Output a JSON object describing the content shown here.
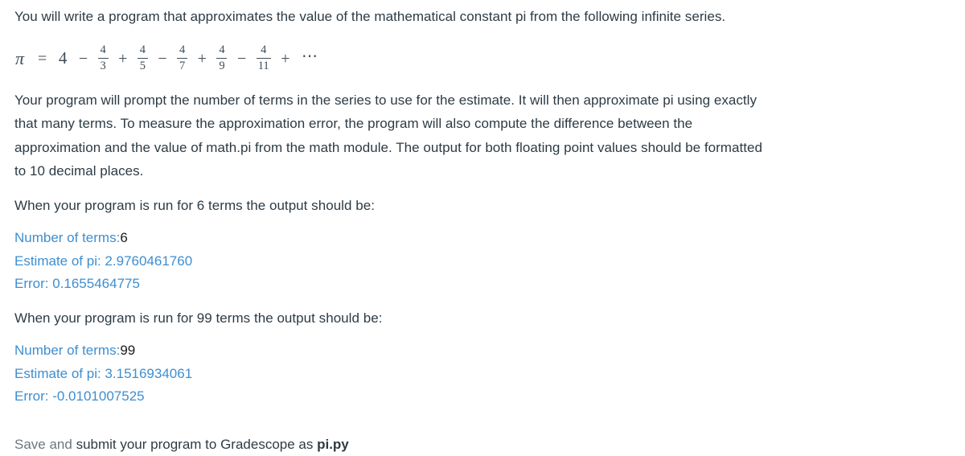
{
  "intro": {
    "paragraph": "You will write a program that approximates the value of the mathematical constant pi from the following infinite series."
  },
  "formula": {
    "lhs": "π",
    "equals": "=",
    "first_term": "4",
    "terms": [
      {
        "op": "−",
        "numerator": "4",
        "denominator": "3"
      },
      {
        "op": "+",
        "numerator": "4",
        "denominator": "5"
      },
      {
        "op": "−",
        "numerator": "4",
        "denominator": "7"
      },
      {
        "op": "+",
        "numerator": "4",
        "denominator": "9"
      },
      {
        "op": "−",
        "numerator": "4",
        "denominator": "11"
      }
    ],
    "trailing_op": "+",
    "ellipsis": "⋯"
  },
  "description": {
    "paragraph": "Your program will prompt the number of terms in the series to use for the estimate. It will then approximate pi using exactly that many terms. To measure the approximation error, the program will also compute the difference between the approximation and the value of math.pi from the math module.  The output for both floating point values should be formatted to 10 decimal places."
  },
  "examples": [
    {
      "prompt": "When your program is run for 6 terms the output should be:",
      "terms_label": "Number of terms:",
      "terms_value": "6",
      "estimate_line": "Estimate of pi: 2.9760461760",
      "error_line": "Error: 0.1655464775"
    },
    {
      "prompt": "When your program is run for 99 terms the output should be:",
      "terms_label": "Number of terms:",
      "terms_value": "99",
      "estimate_line": "Estimate of pi: 3.1516934061",
      "error_line": "Error: -0.0101007525"
    }
  ],
  "submission": {
    "lead": "Save and ",
    "instruction": "submit your program to Gradescope as ",
    "filename": "pi.py"
  },
  "colors": {
    "body_text": "#2d3b45",
    "output_blue": "#3e8ed0",
    "user_input": "#1c1c1c",
    "background": "#ffffff"
  }
}
